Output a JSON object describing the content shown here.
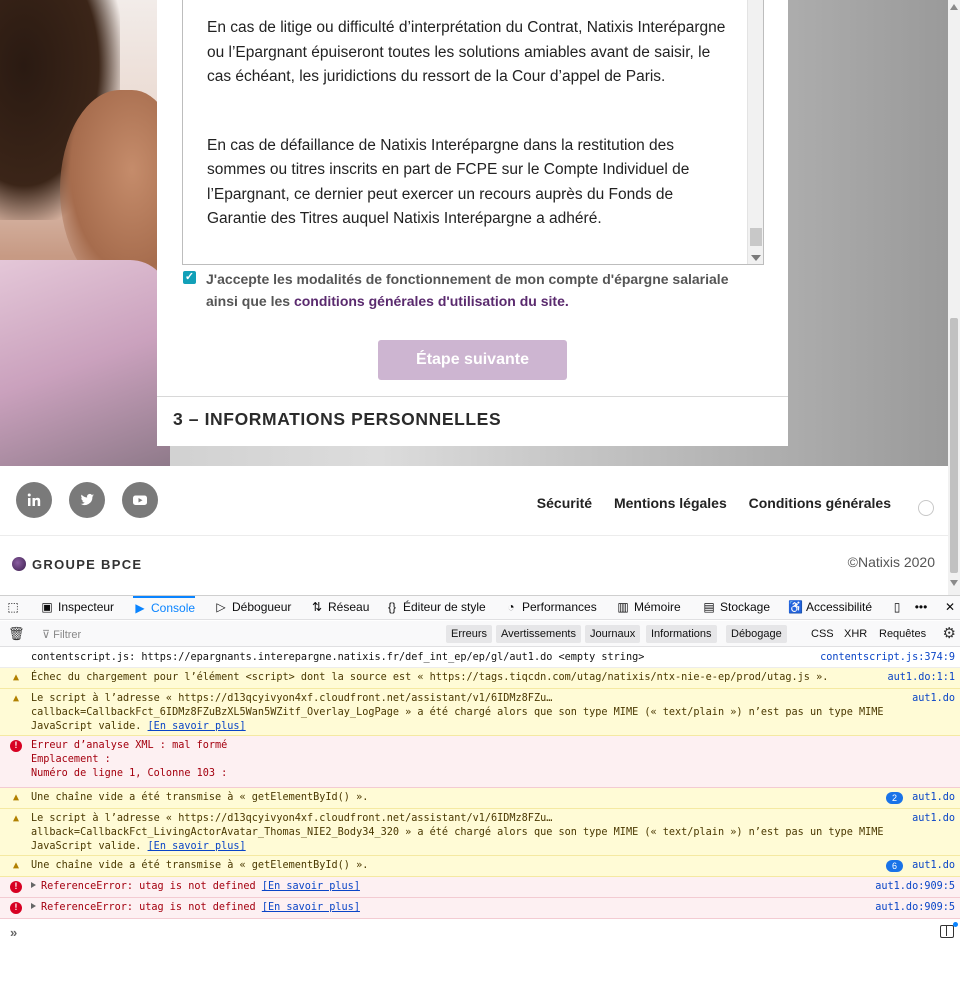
{
  "terms": {
    "paragraph_1": "En cas de litige ou difficulté d’interprétation du Contrat, Natixis Interépargne ou l’Epargnant épuiseront toutes les solutions amiables avant de saisir, le cas échéant, les juridictions du ressort de la Cour d’appel de Paris.",
    "paragraph_2": "En cas de défaillance de Natixis Interépargne dans la restitution des sommes ou titres inscrits en part de FCPE sur le Compte Individuel de l’Epargnant, ce dernier peut exercer un recours auprès du Fonds de Garantie des Titres auquel Natixis Interépargne a adhéré."
  },
  "accept": {
    "text": "J'accepte les modalités de fonctionnement de mon compte d'épargne salariale ainsi que les ",
    "link": "conditions générales d'utilisation du site.",
    "checked": true
  },
  "next_button": "Étape suivante",
  "section_title": "3 – INFORMATIONS PERSONNELLES",
  "footer": {
    "links": [
      "Sécurité",
      "Mentions légales",
      "Conditions générales"
    ],
    "brand": "GROUPE BPCE",
    "copyright": "©Natixis 2020"
  },
  "colors": {
    "accent": "#12a0b8",
    "button": "#cdb5d1",
    "link": "#5a2a6e",
    "devtools_active": "#0a84ff"
  },
  "devtools": {
    "tabs": [
      "Inspecteur",
      "Console",
      "Débogueur",
      "Réseau",
      "Éditeur de style",
      "Performances",
      "Mémoire",
      "Stockage",
      "Accessibilité"
    ],
    "active_tab": "Console",
    "filter_placeholder": "Filtrer",
    "levels": [
      "Erreurs",
      "Avertissements",
      "Journaux",
      "Informations",
      "Débogage"
    ],
    "extra_filters": [
      "CSS",
      "XHR",
      "Requêtes"
    ],
    "messages": [
      {
        "type": "log",
        "text": "contentscript.js: https://epargnants.interepargne.natixis.fr/def_int_ep/ep/gl/aut1.do <empty string>",
        "source": "contentscript.js:374:9"
      },
      {
        "type": "warn",
        "text": "Échec du chargement pour l’élément <script> dont la source est « https://tags.tiqcdn.com/utag/natixis/ntx-nie-e-ep/prod/utag.js ».",
        "source": "aut1.do:1:1"
      },
      {
        "type": "warn",
        "line1": "Le script à l’adresse « https://d13qcyivyon4xf.cloudfront.net/assistant/v1/6IDMz8FZu…",
        "line2": "callback=CallbackFct_6IDMz8FZuBzXL5Wan5WZitf_Overlay_LogPage » a été chargé alors que son type MIME (« text/plain ») n’est pas un type MIME",
        "line3": "JavaScript valide.",
        "link": "[En savoir plus]",
        "source": "aut1.do"
      },
      {
        "type": "err",
        "line1": "Erreur d’analyse XML : mal formé",
        "line2": "Emplacement :",
        "line3": "Numéro de ligne 1, Colonne 103 :"
      },
      {
        "type": "warn",
        "text": "Une chaîne vide a été transmise à « getElementById() ».",
        "count": "2",
        "source": "aut1.do"
      },
      {
        "type": "warn",
        "line1": "Le script à l’adresse « https://d13qcyivyon4xf.cloudfront.net/assistant/v1/6IDMz8FZu…",
        "line2": "allback=CallbackFct_LivingActorAvatar_Thomas_NIE2_Body34_320 » a été chargé alors que son type MIME (« text/plain ») n’est pas un type MIME",
        "line3": "JavaScript valide.",
        "link": "[En savoir plus]",
        "source": "aut1.do"
      },
      {
        "type": "warn",
        "text": "Une chaîne vide a été transmise à « getElementById() ».",
        "count": "6",
        "source": "aut1.do"
      },
      {
        "type": "err",
        "text": "ReferenceError: utag is not defined ",
        "link": "[En savoir plus]",
        "source": "aut1.do:909:5"
      },
      {
        "type": "err",
        "text": "ReferenceError: utag is not defined ",
        "link": "[En savoir plus]",
        "source": "aut1.do:909:5"
      }
    ],
    "prompt": "»"
  }
}
